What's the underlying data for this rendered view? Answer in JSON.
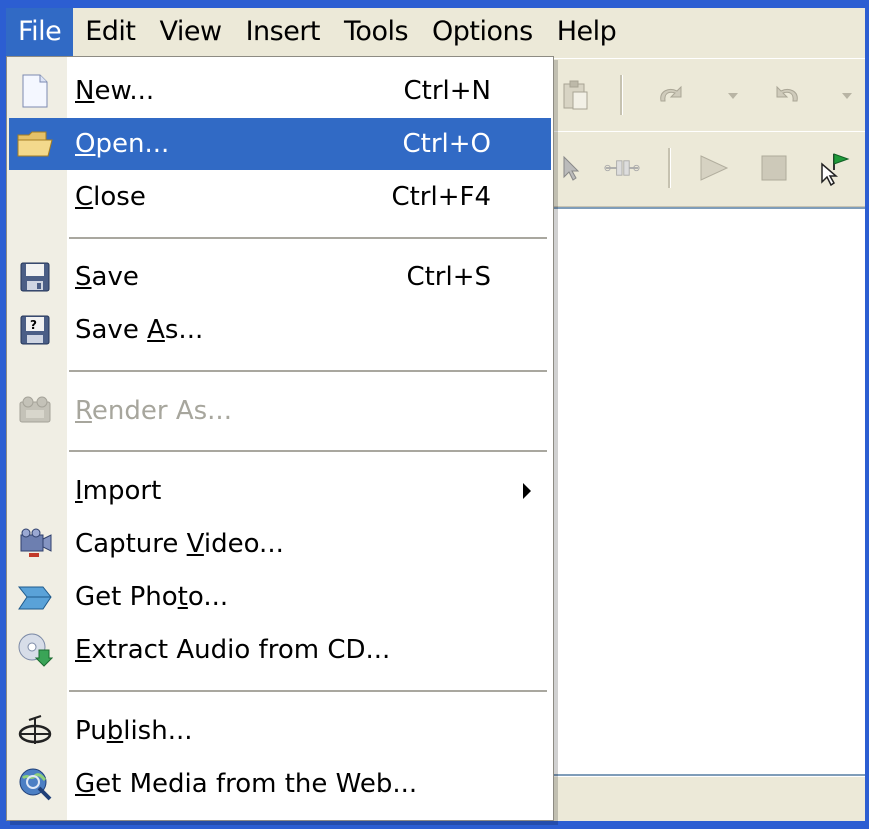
{
  "menubar": {
    "items": [
      {
        "label": "File",
        "active": true
      },
      {
        "label": "Edit"
      },
      {
        "label": "View"
      },
      {
        "label": "Insert"
      },
      {
        "label": "Tools"
      },
      {
        "label": "Options"
      },
      {
        "label": "Help"
      }
    ]
  },
  "toolbar1": {
    "icons": [
      "paste-icon",
      "undo-icon",
      "redo-icon"
    ]
  },
  "toolbar2": {
    "icons": [
      "select-icon",
      "split-icon",
      "play-icon",
      "stop-icon",
      "flag-cursor-icon"
    ]
  },
  "file_menu": {
    "items": [
      {
        "pre": "",
        "ul": "N",
        "post": "ew...",
        "shortcut": "Ctrl+N",
        "icon": "new-document-icon"
      },
      {
        "pre": "",
        "ul": "O",
        "post": "pen...",
        "shortcut": "Ctrl+O",
        "icon": "open-folder-icon",
        "highlighted": true
      },
      {
        "pre": "",
        "ul": "C",
        "post": "lose",
        "shortcut": "Ctrl+F4"
      },
      {
        "pre": "",
        "ul": "S",
        "post": "ave",
        "shortcut": "Ctrl+S",
        "icon": "save-disk-icon"
      },
      {
        "pre": "Save ",
        "ul": "A",
        "post": "s...",
        "icon": "save-as-disk-icon"
      },
      {
        "pre": "",
        "ul": "R",
        "post": "ender As...",
        "icon": "render-icon",
        "disabled": true
      },
      {
        "pre": "",
        "ul": "I",
        "post": "mport",
        "submenu": true
      },
      {
        "pre": "Capture ",
        "ul": "V",
        "post": "ideo...",
        "icon": "capture-video-icon"
      },
      {
        "pre": "Get Pho",
        "ul": "t",
        "post": "o...",
        "icon": "scanner-icon"
      },
      {
        "pre": "",
        "ul": "E",
        "post": "xtract Audio from CD...",
        "icon": "cd-extract-icon"
      },
      {
        "pre": "Pu",
        "ul": "b",
        "post": "lish...",
        "icon": "publish-icon"
      },
      {
        "pre": "",
        "ul": "G",
        "post": "et Media from the Web...",
        "icon": "web-media-icon"
      }
    ]
  },
  "colors": {
    "highlight": "#316ac5",
    "frame": "#2c5ed2",
    "menu_bg": "#ece9d8",
    "disabled_text": "#a7a69d"
  }
}
